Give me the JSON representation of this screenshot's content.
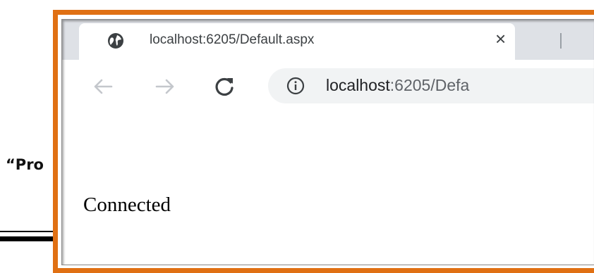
{
  "document": {
    "fragment_text": "“Pro"
  },
  "browser": {
    "tab": {
      "favicon": "globe-icon",
      "title": "localhost:6205/Default.aspx",
      "close_label": "×"
    },
    "toolbar": {
      "back_icon": "arrow-left-icon",
      "forward_icon": "arrow-right-icon",
      "reload_icon": "reload-icon",
      "address": {
        "info_icon": "info-icon",
        "host": "localhost",
        "rest": ":6205/Defa"
      }
    },
    "page": {
      "status_text": "Connected"
    }
  },
  "colors": {
    "frame_border": "#e07013",
    "tabstrip": "#dee1e6",
    "omnibox": "#f1f3f4"
  }
}
